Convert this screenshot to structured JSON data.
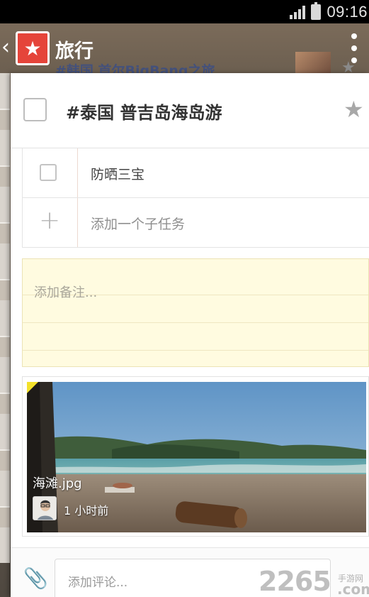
{
  "status_bar": {
    "time": "09:16",
    "signal_icon": "signal-bars-icon",
    "battery_icon": "battery-icon"
  },
  "app_bar": {
    "title": "旅行",
    "back_icon": "chevron-left-icon",
    "logo_icon": "star-logo-icon",
    "menu_icon": "overflow-menu-icon"
  },
  "background_list": {
    "visible_item": "#韩国 首尔BigBang之旅"
  },
  "task": {
    "title": "#泰国 普吉岛海岛游",
    "starred": false,
    "star_icon": "star-icon"
  },
  "subtasks": {
    "items": [
      {
        "label": "防晒三宝",
        "checked": false
      }
    ],
    "add_placeholder": "添加一个子任务",
    "add_icon": "plus-icon"
  },
  "notes": {
    "placeholder": "添加备注..."
  },
  "attachment": {
    "file_name": "海滩.jpg",
    "time_ago": "1 小时前"
  },
  "comment": {
    "placeholder": "添加评论...",
    "attach_icon": "paperclip-icon"
  },
  "watermark": {
    "brand": "2265",
    "sub": "手游网",
    "suffix": ".com"
  },
  "colors": {
    "accent_red": "#e5443a",
    "notes_yellow": "#fffbe0",
    "header_brown": "#7b6b5a"
  }
}
